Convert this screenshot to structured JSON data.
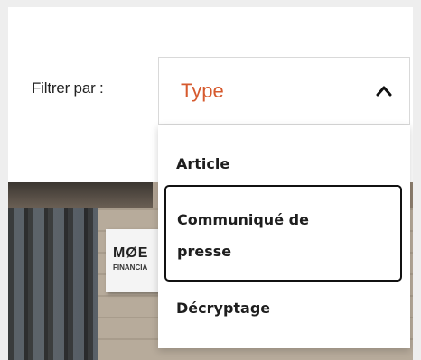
{
  "filter": {
    "label": "Filtrer par :",
    "selected_value": "Type",
    "accent_color": "#d65a2e",
    "options": [
      {
        "label": "Article"
      },
      {
        "label": "Communiqué de presse",
        "focused": true
      },
      {
        "label": "Décryptage"
      }
    ]
  },
  "photo": {
    "sign_main": "MØE",
    "sign_sub": "FINANCIA"
  },
  "icons": {
    "chevron": "chevron-up-icon"
  }
}
